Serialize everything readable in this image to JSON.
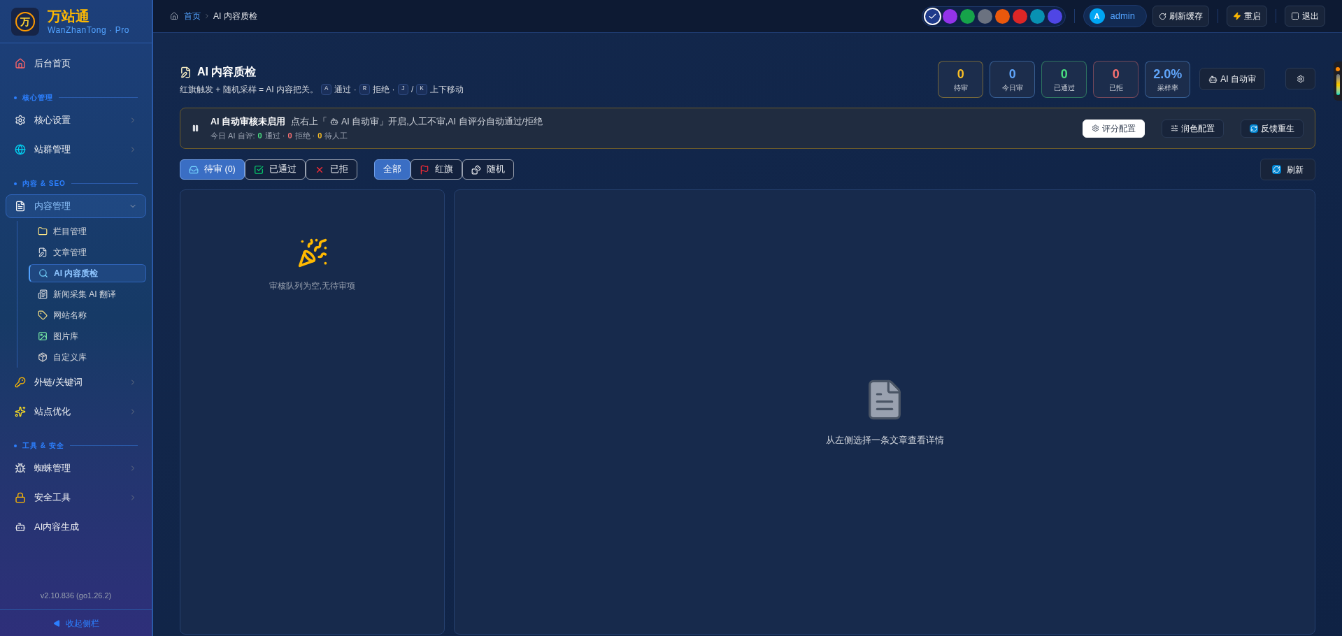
{
  "brand": {
    "name": "万站通",
    "subtitle": "WanZhanTong · Pro",
    "logo_letter": "万"
  },
  "sidebar": {
    "items": [
      {
        "kind": "item",
        "label": "后台首页",
        "selected": false
      },
      {
        "kind": "section",
        "label": "核心管理"
      },
      {
        "kind": "item",
        "label": "核心设置",
        "selected": false,
        "expanded": false
      },
      {
        "kind": "item",
        "label": "站群管理",
        "selected": false,
        "expanded": false
      },
      {
        "kind": "section",
        "label": "内容 & SEO"
      },
      {
        "kind": "item",
        "label": "内容管理",
        "selected": true,
        "expanded": true,
        "children": [
          {
            "label": "栏目管理",
            "selected": false
          },
          {
            "label": "文章管理",
            "selected": false
          },
          {
            "label": "AI 内容质检",
            "selected": true
          },
          {
            "label": "新闻采集 AI 翻译",
            "selected": false
          },
          {
            "label": "网站名称",
            "selected": false
          },
          {
            "label": "图片库",
            "selected": false
          },
          {
            "label": "自定义库",
            "selected": false
          }
        ]
      },
      {
        "kind": "item",
        "label": "外链/关键词",
        "selected": false,
        "expanded": false
      },
      {
        "kind": "item",
        "label": "站点优化",
        "selected": false,
        "expanded": false
      },
      {
        "kind": "section",
        "label": "工具 & 安全"
      },
      {
        "kind": "item",
        "label": "蜘蛛管理",
        "selected": false,
        "expanded": false
      },
      {
        "kind": "item",
        "label": "安全工具",
        "selected": false,
        "expanded": false
      },
      {
        "kind": "item",
        "label": "AI内容生成",
        "selected": false
      }
    ],
    "version": "v2.10.836 (go1.26.2)",
    "collapse": "收起侧栏"
  },
  "breadcrumb": [
    "首页",
    "AI 内容质检"
  ],
  "themes": [
    {
      "color": "#1e3a8a",
      "selected": true
    },
    {
      "color": "#9333ea",
      "selected": false
    },
    {
      "color": "#16a34a",
      "selected": false
    },
    {
      "color": "#6b7280",
      "selected": false
    },
    {
      "color": "#ea580c",
      "selected": false
    },
    {
      "color": "#dc2626",
      "selected": false
    },
    {
      "color": "#0891b2",
      "selected": false
    },
    {
      "color": "#4f46e5",
      "selected": false
    }
  ],
  "user": {
    "initial": "A",
    "name": "admin"
  },
  "header_buttons": [
    "刷新缓存",
    "重启",
    "退出"
  ],
  "page": {
    "title": "AI 内容质检",
    "subtitle": [
      {
        "kind": "text",
        "text": "红旗触发 + 随机采样 = AI 内容把关。"
      },
      {
        "kind": "key",
        "text": "A"
      },
      {
        "kind": "text",
        "text": "通过 ·"
      },
      {
        "kind": "key",
        "text": "R"
      },
      {
        "kind": "text",
        "text": "拒绝 ·"
      },
      {
        "kind": "key",
        "text": "J"
      },
      {
        "kind": "text",
        "text": "/"
      },
      {
        "kind": "key",
        "text": "K"
      },
      {
        "kind": "text",
        "text": "上下移动"
      }
    ]
  },
  "stats": [
    {
      "value": "0",
      "label": "待审",
      "color": "#fbbf24"
    },
    {
      "value": "0",
      "label": "今日审",
      "color": "#60a5fa"
    },
    {
      "value": "0",
      "label": "已通过",
      "color": "#4ade80"
    },
    {
      "value": "0",
      "label": "已拒",
      "color": "#f87171"
    },
    {
      "value": "2.0%",
      "label": "采样率",
      "color": "#60a5fa"
    }
  ],
  "auto_review_button": "AI 自动审",
  "banner": {
    "title": "AI 自动审核未启用",
    "hint": "点右上「",
    "hint_button": "AI 自动审",
    "hint_rest": "」开启,人工不审,AI 自评分自动通过/拒绝",
    "summary": [
      {
        "text": "今日 AI 自评:"
      },
      {
        "text": "0",
        "color": "#4ade80"
      },
      {
        "text": "通过 ·"
      },
      {
        "text": "0",
        "color": "#f87171"
      },
      {
        "text": "拒绝 ·"
      },
      {
        "text": "0",
        "color": "#fbbf24"
      },
      {
        "text": "待人工"
      }
    ],
    "buttons": [
      {
        "label": "评分配置",
        "selected": true
      },
      {
        "label": "润色配置",
        "selected": false
      },
      {
        "label": "反馈重生",
        "selected": false
      }
    ]
  },
  "status_tabs": [
    {
      "label": "待审 (0)",
      "selected": true
    },
    {
      "label": "已通过",
      "selected": false
    },
    {
      "label": "已拒",
      "selected": false
    }
  ],
  "source_tabs": [
    {
      "label": "全部",
      "selected": true
    },
    {
      "label": "红旗",
      "selected": false
    },
    {
      "label": "随机",
      "selected": false
    }
  ],
  "refresh_button": "刷新",
  "queue": {
    "empty_text": "审核队列为空,无待审项"
  },
  "detail": {
    "empty_text": "从左侧选择一条文章查看详情"
  }
}
